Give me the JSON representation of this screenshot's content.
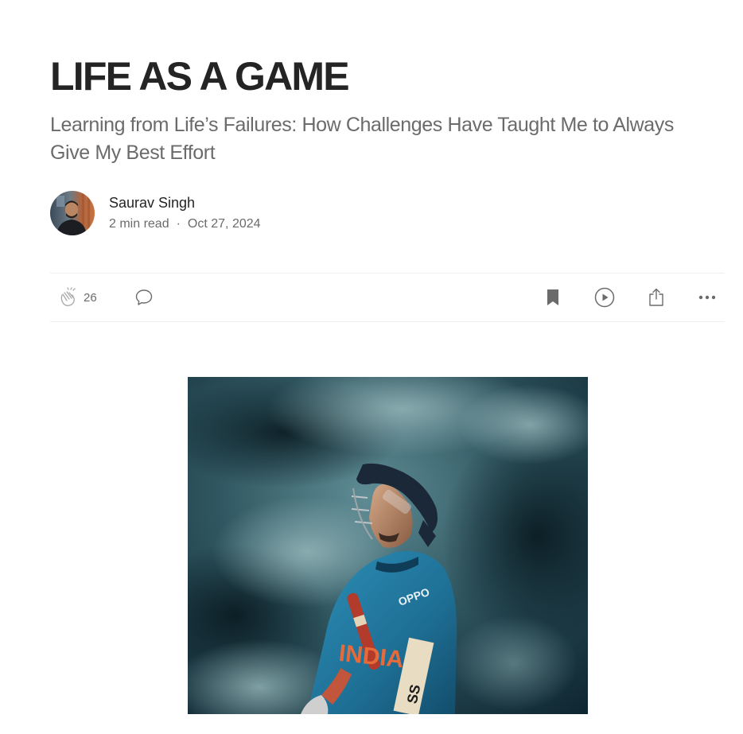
{
  "article": {
    "title": "LIFE AS A GAME",
    "subtitle": "Learning from Life’s Failures: How Challenges Have Taught Me to Always Give My Best Effort"
  },
  "author": {
    "name": "Saurav Singh",
    "read_time": "2 min read",
    "separator": "·",
    "date": "Oct 27, 2024"
  },
  "actions": {
    "clap_count": "26",
    "icons": [
      "clap-icon",
      "comment-icon",
      "bookmark-icon",
      "listen-icon",
      "share-icon",
      "more-icon"
    ]
  },
  "colors": {
    "text_primary": "#242424",
    "text_secondary": "#6b6b6b",
    "divider": "#f0f0f0",
    "icon": "#6b6b6b"
  },
  "hero_image": {
    "jersey_text": "INDIA",
    "sponsor_text": "OPPO"
  }
}
